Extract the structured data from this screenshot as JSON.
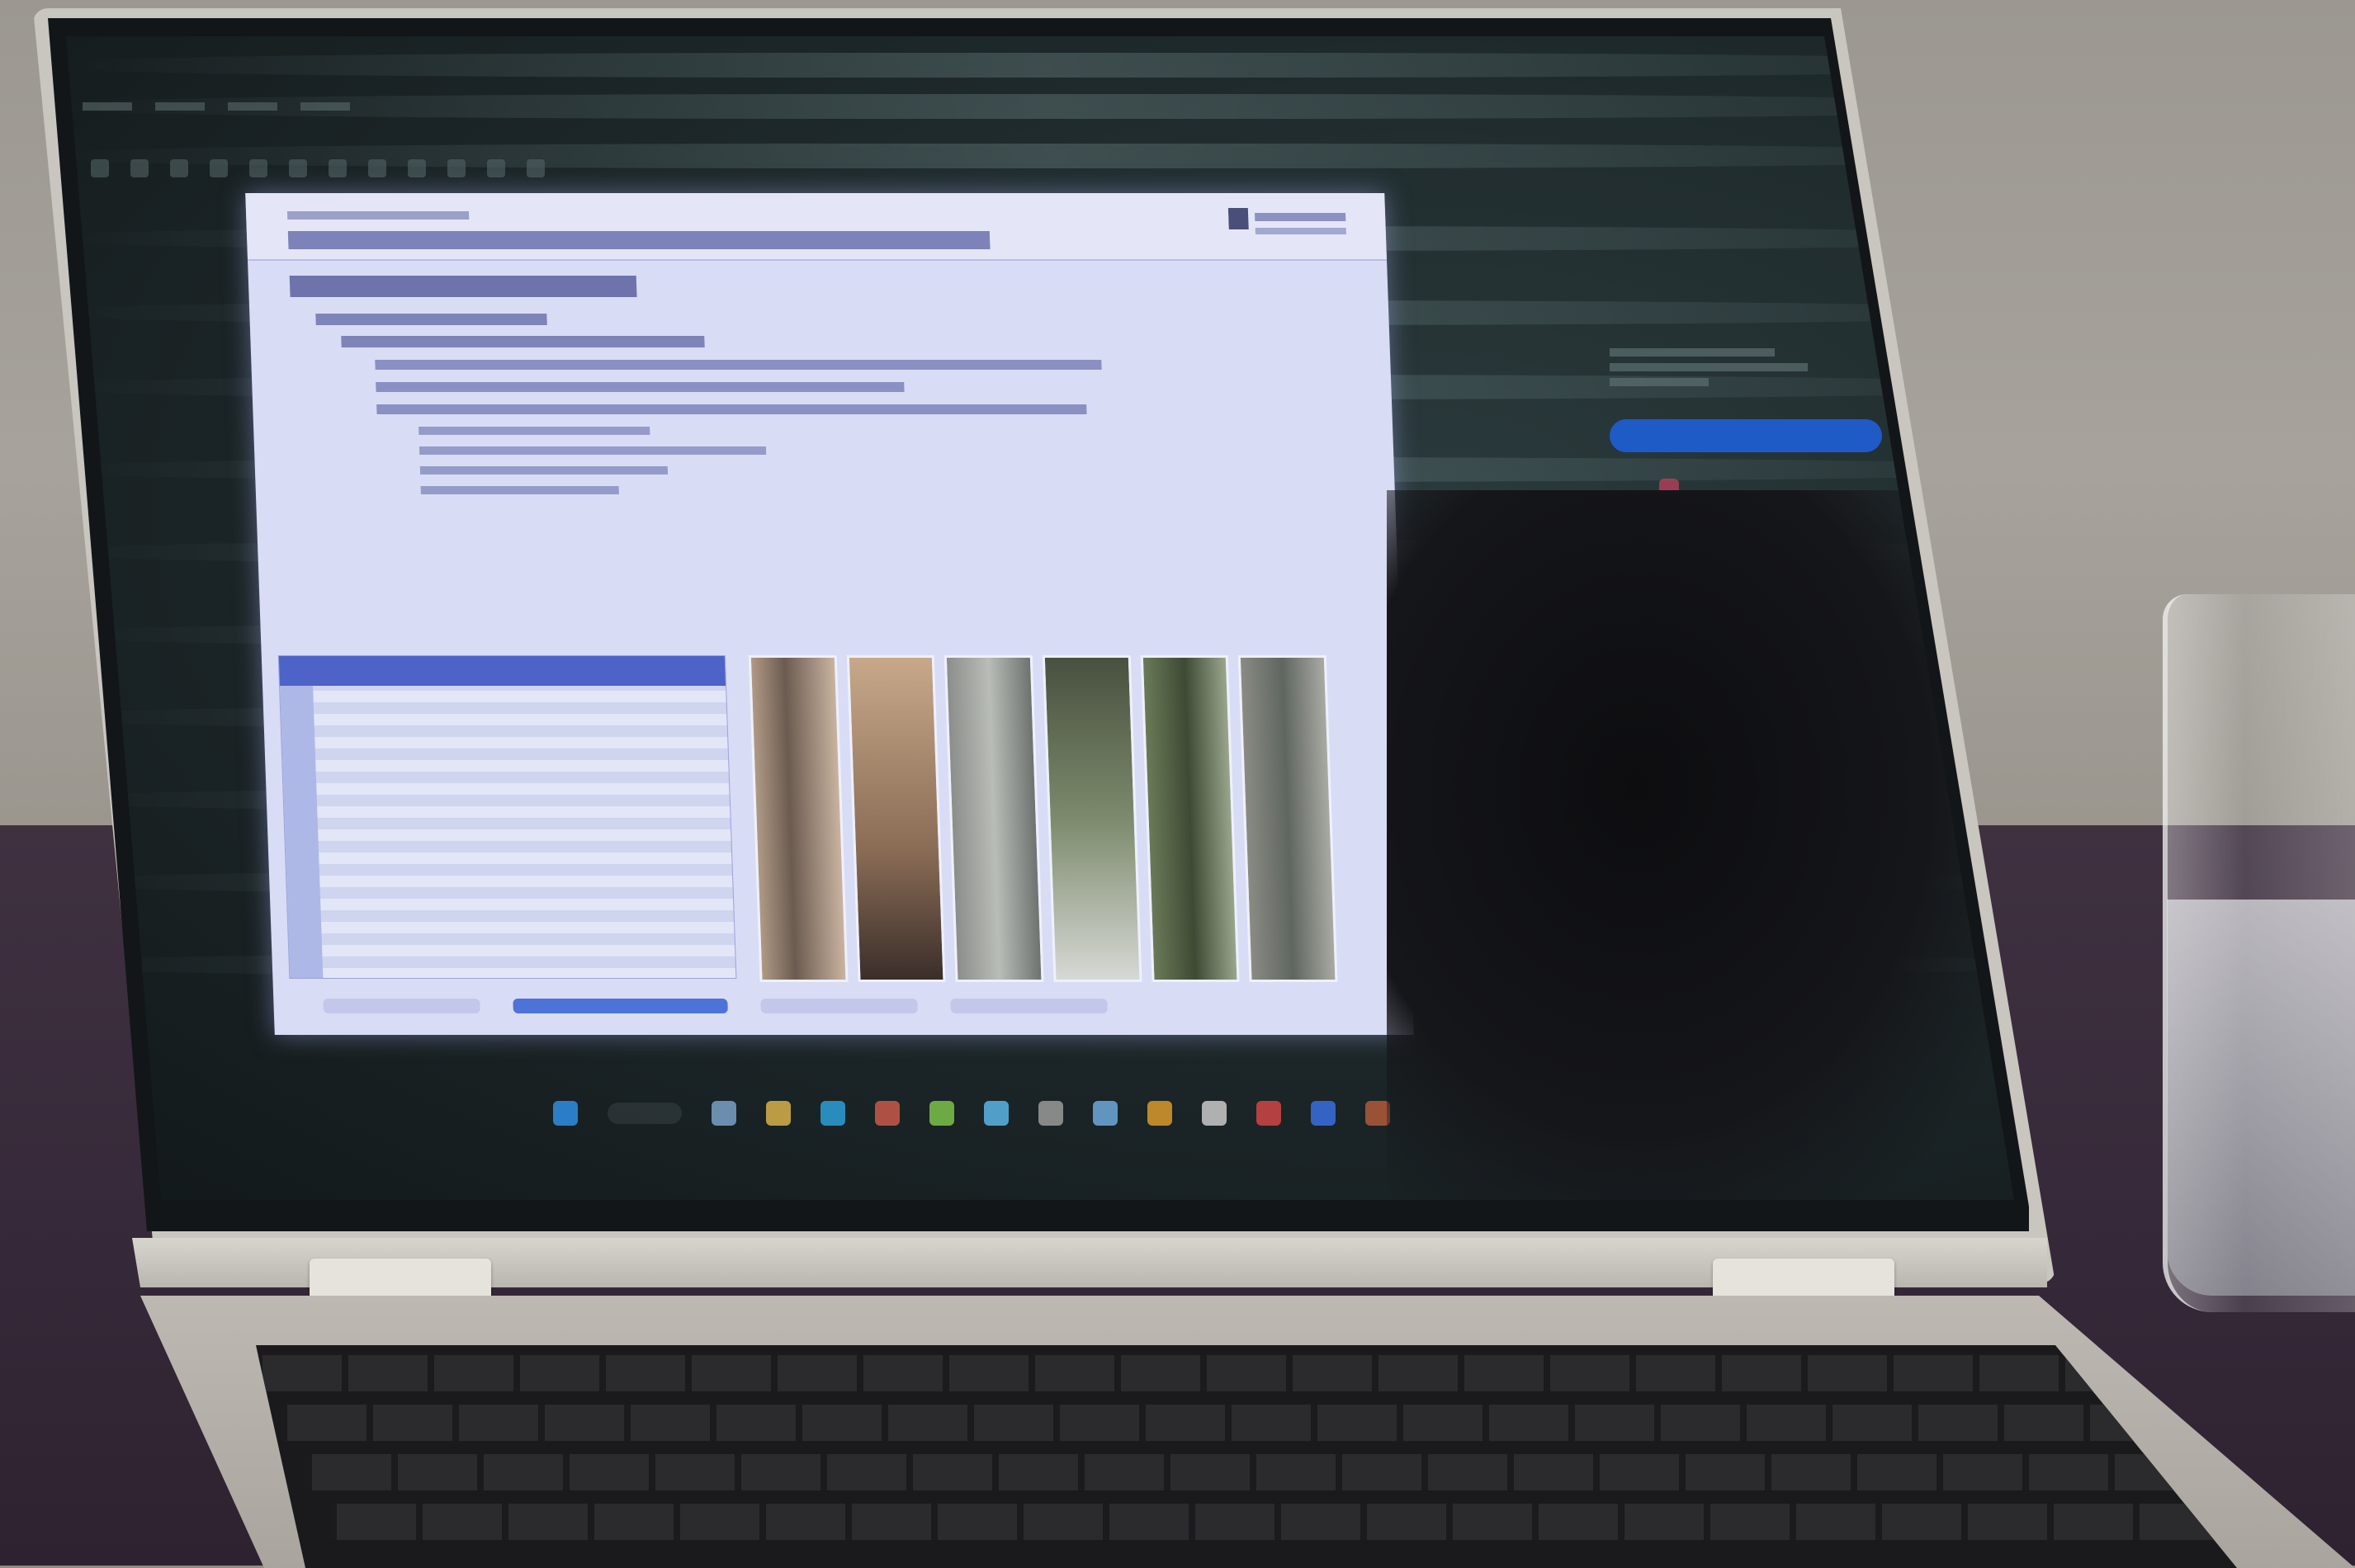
{
  "document": {
    "title": "",
    "section_heading": "",
    "bullets": [],
    "tabs": [
      "",
      "",
      "",
      ""
    ]
  },
  "side_panel": {
    "items": [
      "",
      "",
      "",
      "",
      "",
      ""
    ],
    "primary_button": "",
    "cta_button": ""
  },
  "colors": {
    "doc_bg": "#d9dcf5",
    "accent_blue": "#2563eb",
    "table_header": "#4e63c7",
    "screen_bg": "#1c2628"
  },
  "icons": [
    "start-menu-icon",
    "search-icon",
    "file-explorer-icon",
    "edge-icon",
    "settings-icon",
    "store-icon",
    "mail-icon"
  ]
}
